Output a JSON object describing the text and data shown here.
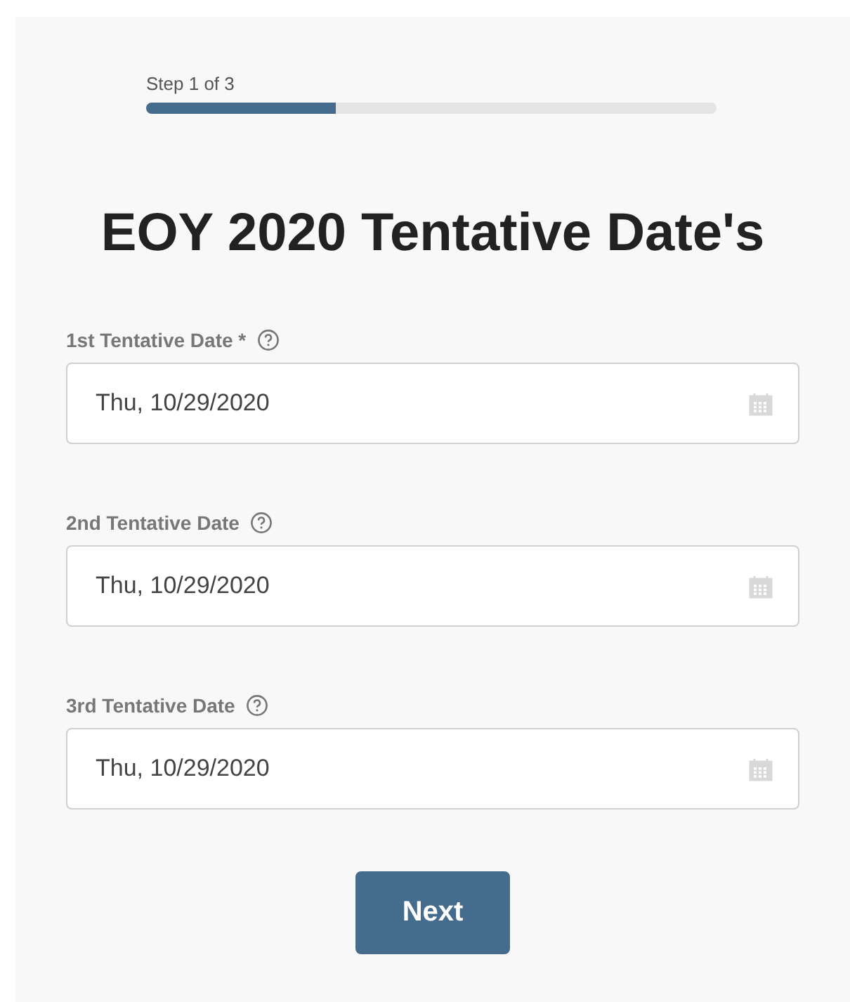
{
  "progress": {
    "label": "Step 1 of 3",
    "level": 0.333
  },
  "title": "EOY 2020 Tentative Date's",
  "fields": [
    {
      "label": "1st Tentative Date *",
      "value": "Thu, 10/29/2020"
    },
    {
      "label": "2nd Tentative Date",
      "value": "Thu, 10/29/2020"
    },
    {
      "label": "3rd Tentative Date",
      "value": "Thu, 10/29/2020"
    }
  ],
  "button": "Next"
}
